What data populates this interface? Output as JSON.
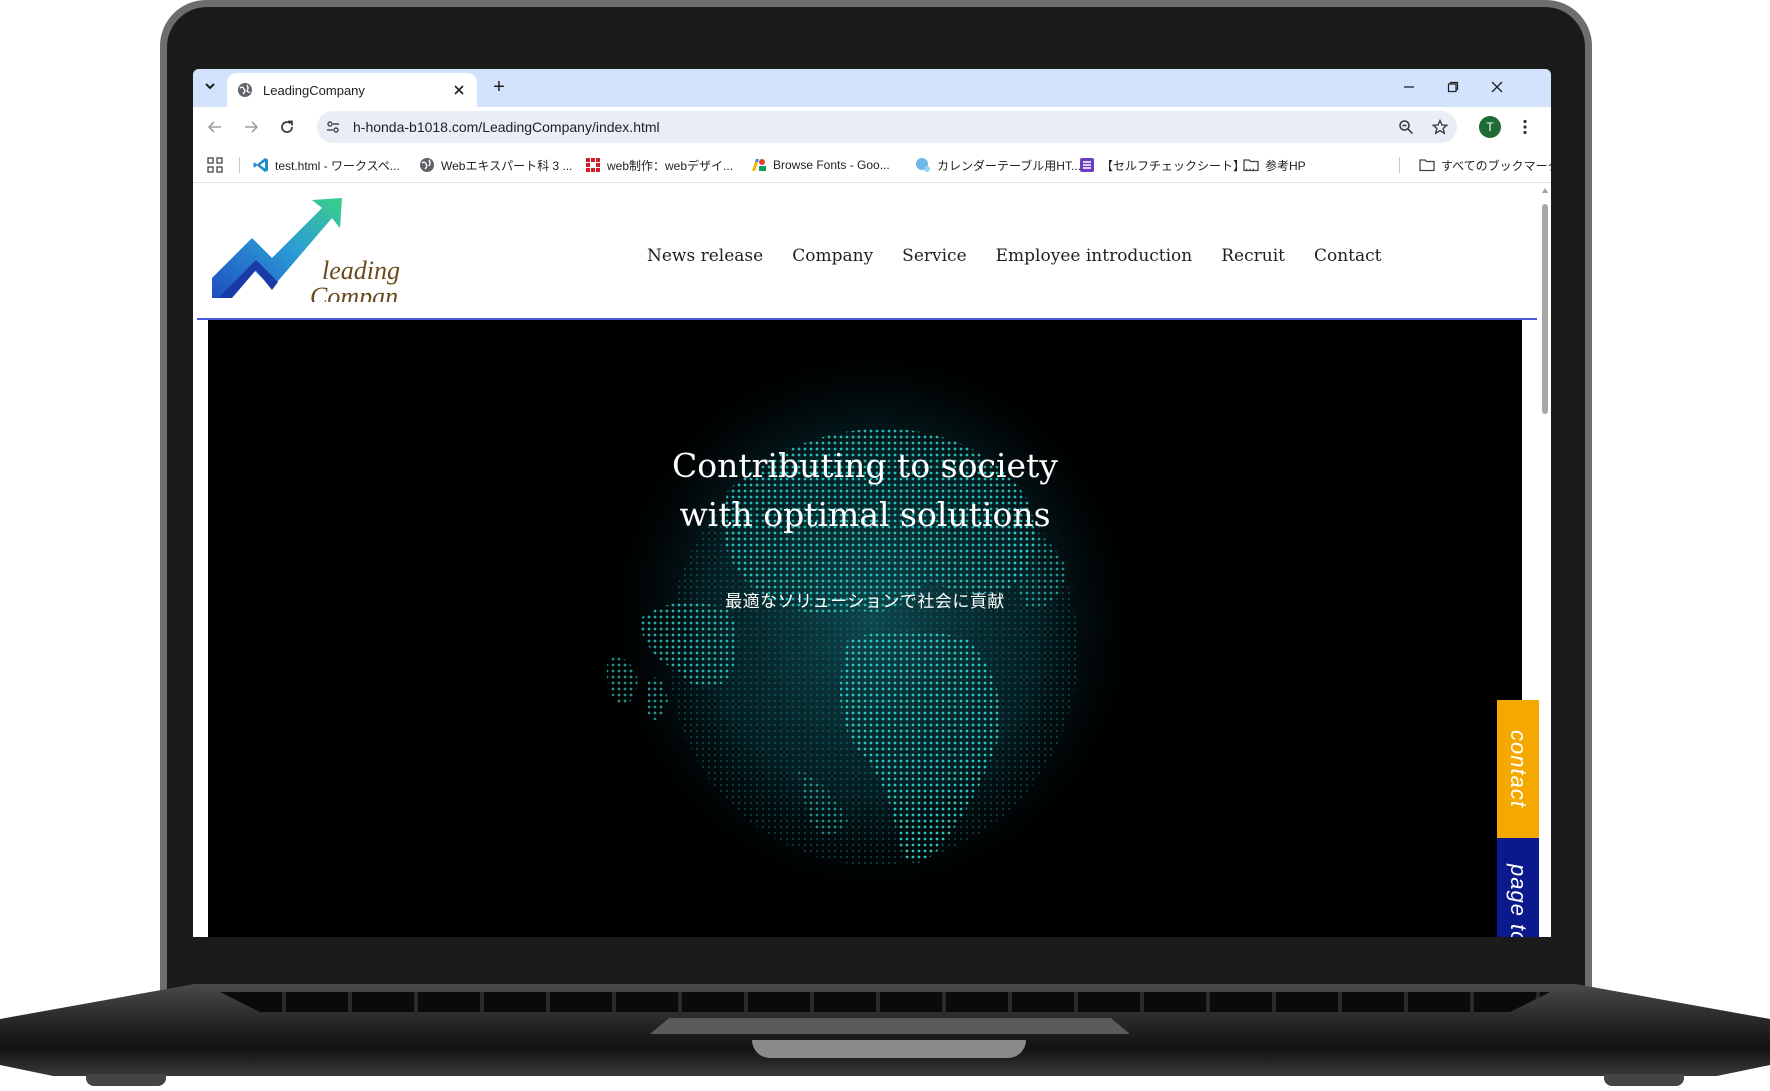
{
  "browser": {
    "tab_title": "LeadingCompany",
    "new_tab_symbol": "+",
    "url": "h-honda-b1018.com/LeadingCompany/index.html",
    "profile_initial": "T",
    "bookmarks": [
      {
        "label": "test.html - ワークスペ...",
        "icon": "vscode-icon"
      },
      {
        "label": "Webエキスパート科 3 ...",
        "icon": "globe-icon"
      },
      {
        "label": "web制作：webデザイ...",
        "icon": "grid-red-icon"
      },
      {
        "label": "Browse Fonts - Goo...",
        "icon": "google-fonts-icon"
      },
      {
        "label": "カレンダーテーブル用HT...",
        "icon": "bubble-icon"
      },
      {
        "label": "【セルフチェックシート】...",
        "icon": "list-purple-icon"
      },
      {
        "label": "参考HP",
        "icon": "folder-icon"
      }
    ],
    "all_bookmarks": "すべてのブックマーク"
  },
  "site": {
    "logo_line1": "leading",
    "logo_line2": "Compan",
    "nav": [
      "News release",
      "Company",
      "Service",
      "Employee introduction",
      "Recruit",
      "Contact"
    ],
    "hero_title_line1": "Contributing to society",
    "hero_title_line2": "with optimal solutions",
    "hero_subtitle": "最適なソリューションで社会に貢献",
    "side_contact": "contact",
    "side_pagetop": "page top"
  },
  "colors": {
    "tabstrip": "#d3e3fd",
    "header_border": "#4a5de0",
    "contact_btn": "#f5a800",
    "pagetop_btn": "#0a1a8c",
    "globe": "#1fb5b5"
  }
}
